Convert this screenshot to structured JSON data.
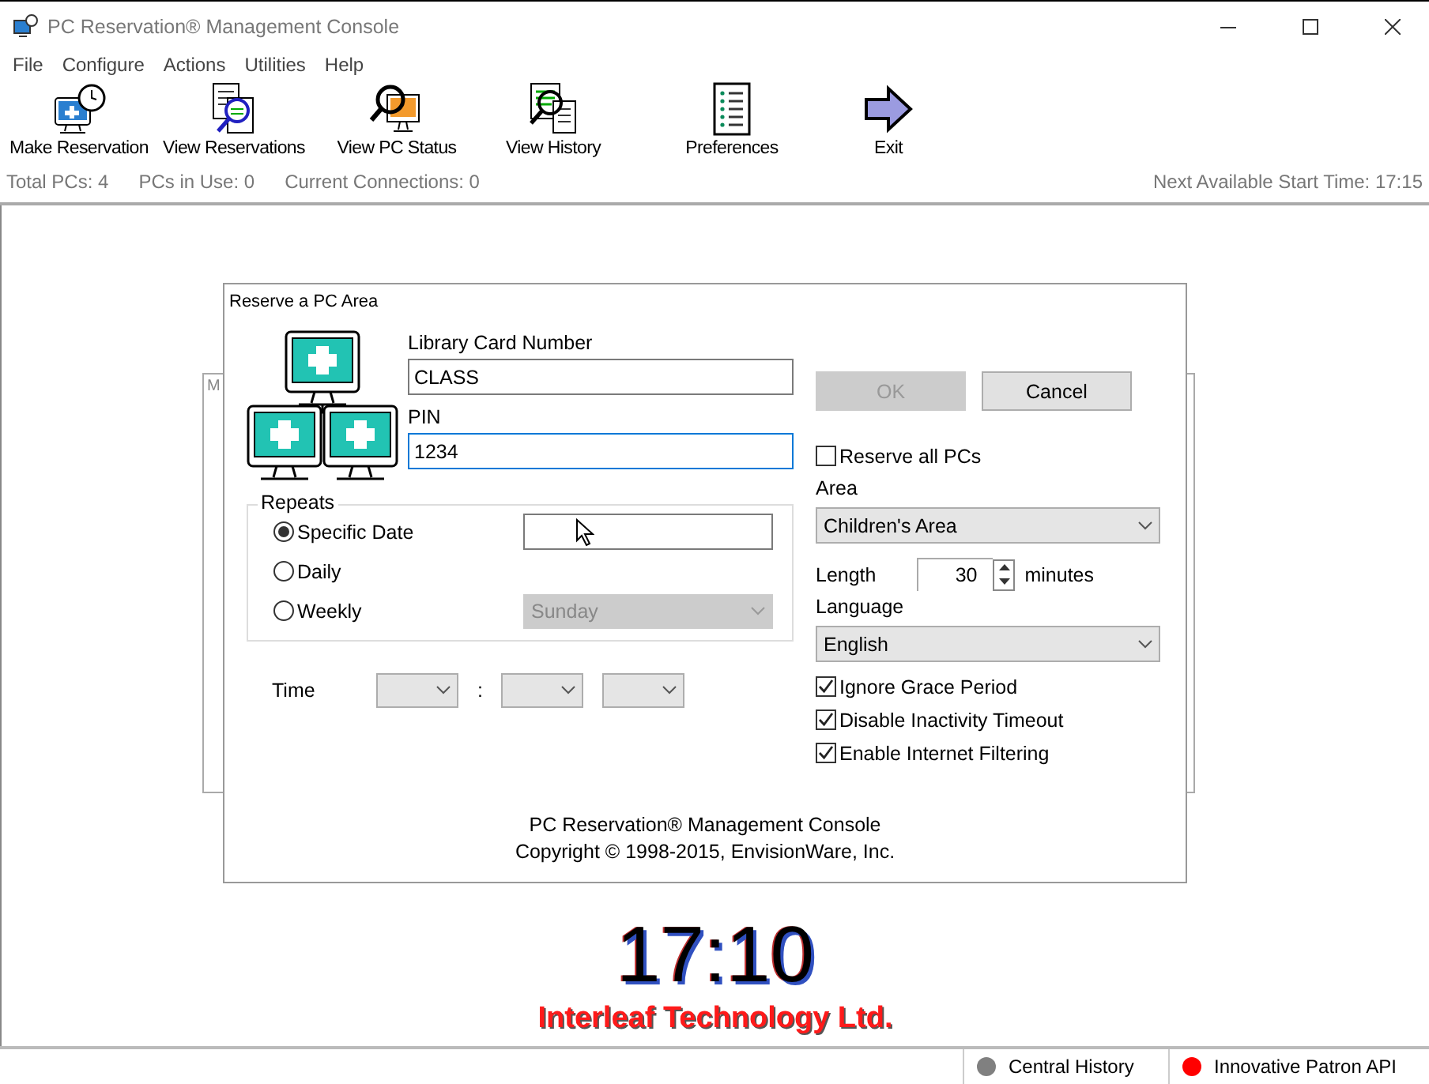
{
  "window": {
    "title": "PC Reservation® Management Console"
  },
  "menu": [
    "File",
    "Configure",
    "Actions",
    "Utilities",
    "Help"
  ],
  "toolbar": [
    {
      "label": "Make Reservation",
      "kind": "reserve"
    },
    {
      "label": "View Reservations",
      "kind": "reservations"
    },
    {
      "label": "View PC Status",
      "kind": "status"
    },
    {
      "label": "View History",
      "kind": "history"
    },
    {
      "label": "Preferences",
      "kind": "preferences"
    },
    {
      "label": "Exit",
      "kind": "exit"
    }
  ],
  "info_bar": {
    "total": "Total PCs: 4",
    "in_use": "PCs in Use: 0",
    "connections": "Current Connections: 0",
    "next_start": "Next Available Start Time: 17:15"
  },
  "background_panel": {
    "label": "M"
  },
  "dialog": {
    "title": "Reserve a PC Area",
    "fields": [
      {
        "label": "Library Card Number",
        "value": "CLASS",
        "focused": false
      },
      {
        "label": "PIN",
        "value": "1234",
        "focused": true
      }
    ],
    "repeats": {
      "title": "Repeats",
      "options": [
        {
          "label": "Specific Date",
          "selected": true
        },
        {
          "label": "Daily",
          "selected": false
        },
        {
          "label": "Weekly",
          "selected": false
        }
      ],
      "weekday": {
        "value": "Sunday",
        "disabled": true
      }
    },
    "time": {
      "label": "Time",
      "separator": ":"
    },
    "buttons": [
      {
        "label": "OK",
        "disabled": true
      },
      {
        "label": "Cancel",
        "disabled": false
      }
    ],
    "reserve_all": {
      "label": "Reserve all PCs",
      "checked": false
    },
    "area": {
      "label": "Area",
      "value": "Children's Area"
    },
    "length": {
      "label": "Length",
      "value": "30",
      "unit": "minutes"
    },
    "language": {
      "label": "Language",
      "value": "English"
    },
    "options": [
      {
        "label": "Ignore Grace Period",
        "checked": true
      },
      {
        "label": "Disable Inactivity Timeout",
        "checked": true
      },
      {
        "label": "Enable Internet Filtering",
        "checked": true
      }
    ],
    "footer": [
      "PC Reservation® Management Console",
      "Copyright © 1998-2015, EnvisionWare, Inc."
    ]
  },
  "clock": "17:10",
  "company": "Interleaf Technology Ltd.",
  "status_bar": [
    {
      "label": "Central History",
      "color": "#808080"
    },
    {
      "label": "Innovative Patron API",
      "color": "#ff0000"
    }
  ]
}
